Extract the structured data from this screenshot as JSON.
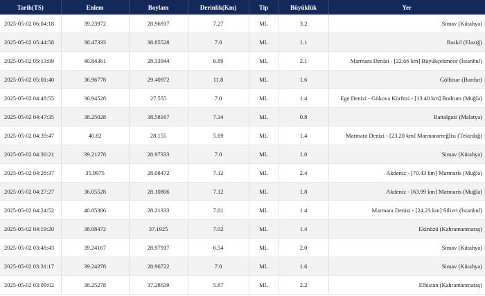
{
  "table": {
    "headers": [
      "Tarih(TS)",
      "Enlem",
      "Boylam",
      "Derinlik(Km)",
      "Tip",
      "Büyüklük",
      "Yer"
    ],
    "rows": [
      [
        "2025-05-02 06:04:18",
        "39.23972",
        "28.96917",
        "7.27",
        "ML",
        "3.2",
        "Simav (Kütahya)"
      ],
      [
        "2025-05-02 05:44:58",
        "38.47333",
        "38.85528",
        "7.0",
        "ML",
        "1.1",
        "Baskil (Elazığ)"
      ],
      [
        "2025-05-02 05:13:09",
        "40.84361",
        "28.33944",
        "6.89",
        "ML",
        "2.1",
        "Marmara Denizi - [22.66 km] Büyükçekmece (İstanbul)"
      ],
      [
        "2025-05-02 05:01:40",
        "36.96778",
        "29.40972",
        "11.8",
        "ML",
        "1.6",
        "Gölhisar (Burdur)"
      ],
      [
        "2025-05-02 04:48:55",
        "36.94528",
        "27.555",
        "7.0",
        "ML",
        "1.4",
        "Ege Denizi - Gökova Körfezi - [13.40 km] Bodrum (Muğla)"
      ],
      [
        "2025-05-02 04:47:35",
        "38.25028",
        "38.58167",
        "7.34",
        "ML",
        "0.8",
        "Battalgazi (Malatya)"
      ],
      [
        "2025-05-02 04:39:47",
        "40.82",
        "28.155",
        "5.69",
        "ML",
        "1.4",
        "Marmara Denizi - [23.20 km] Marmaraereğlisi (Tekirdağ)"
      ],
      [
        "2025-05-02 04:36:21",
        "39.21278",
        "28.97333",
        "7.0",
        "ML",
        "1.0",
        "Simav (Kütahya)"
      ],
      [
        "2025-05-02 04:28:37",
        "35.9975",
        "28.08472",
        "7.12",
        "ML",
        "2.4",
        "Akdeniz - [70.43 km] Marmaris (Muğla)"
      ],
      [
        "2025-05-02 04:27:27",
        "36.05528",
        "28.10806",
        "7.12",
        "ML",
        "1.8",
        "Akdeniz - [63.99 km] Marmaris (Muğla)"
      ],
      [
        "2025-05-02 04:24:52",
        "40.85306",
        "28.21333",
        "7.01",
        "ML",
        "1.4",
        "Marmara Denizi - [24.23 km] Silivri (İstanbul)"
      ],
      [
        "2025-05-02 04:19:20",
        "38.08472",
        "37.1925",
        "7.02",
        "ML",
        "1.4",
        "Ekinözü (Kahramanmaraş)"
      ],
      [
        "2025-05-02 03:48:43",
        "39.24167",
        "28.97917",
        "6.54",
        "ML",
        "2.0",
        "Simav (Kütahya)"
      ],
      [
        "2025-05-02 03:31:17",
        "39.24278",
        "28.96722",
        "7.0",
        "ML",
        "1.6",
        "Simav (Kütahya)"
      ],
      [
        "2025-05-02 03:09:02",
        "38.25278",
        "37.28639",
        "5.87",
        "ML",
        "2.2",
        "Elbistan (Kahramanmaraş)"
      ]
    ]
  },
  "colors": {
    "header_bg": "#14285a",
    "header_text": "#ffffff",
    "row_alt": "#f2f2f2"
  }
}
